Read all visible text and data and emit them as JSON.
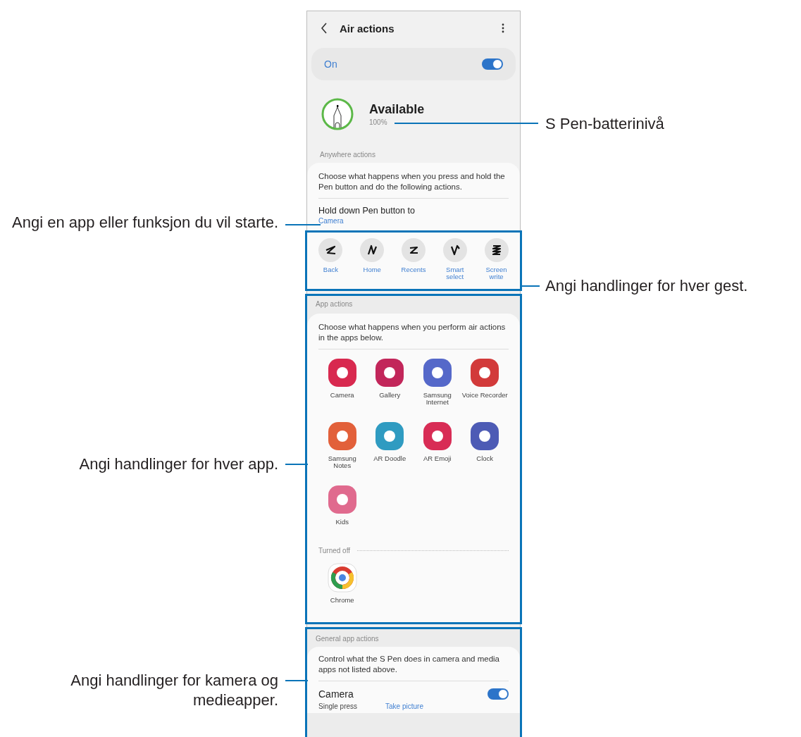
{
  "screen": {
    "title": "Air actions",
    "master": {
      "label": "On",
      "on": true
    },
    "status": {
      "title": "Available",
      "battery": "100%"
    },
    "anywhere": {
      "header": "Anywhere actions",
      "description": "Choose what happens when you press and hold the Pen button and do the following actions.",
      "hold_label": "Hold down Pen button to",
      "hold_value": "Camera",
      "gestures": [
        {
          "label": "Back"
        },
        {
          "label": "Home"
        },
        {
          "label": "Recents"
        },
        {
          "label": "Smart select"
        },
        {
          "label": "Screen write"
        }
      ]
    },
    "app_actions": {
      "header": "App actions",
      "description": "Choose what happens when you perform air actions in the apps below.",
      "apps": [
        {
          "label": "Camera",
          "color": "#d8294f",
          "kind": "tile"
        },
        {
          "label": "Gallery",
          "color": "#c2265a",
          "kind": "tile"
        },
        {
          "label": "Samsung Internet",
          "color": "#5568c9",
          "kind": "tile"
        },
        {
          "label": "Voice Recorder",
          "color": "#d23a3a",
          "kind": "tile"
        },
        {
          "label": "Samsung Notes",
          "color": "#e2603a",
          "kind": "tile"
        },
        {
          "label": "AR Doodle",
          "color": "#2f9bc1",
          "kind": "tile"
        },
        {
          "label": "AR Emoji",
          "color": "#d82c55",
          "kind": "tile"
        },
        {
          "label": "Clock",
          "color": "#4d5bb5",
          "kind": "tile"
        },
        {
          "label": "Kids",
          "color": "#e06a8e",
          "kind": "tile"
        }
      ],
      "turned_off_header": "Turned off",
      "turned_off_apps": [
        {
          "label": "Chrome",
          "kind": "ring"
        }
      ]
    },
    "general": {
      "header": "General app actions",
      "description": "Control what the S Pen does in camera and media apps not listed above.",
      "item_title": "Camera",
      "item_on": true,
      "action_label": "Single press",
      "action_value": "Take picture"
    }
  },
  "callouts": [
    {
      "text": "S Pen-batterinivå"
    },
    {
      "text": "Angi en app eller funksjon du vil starte."
    },
    {
      "text": "Angi handlinger for hver gest."
    },
    {
      "text": "Angi handlinger for hver app."
    },
    {
      "text": "Angi handlinger for kamera og medieapper."
    }
  ]
}
